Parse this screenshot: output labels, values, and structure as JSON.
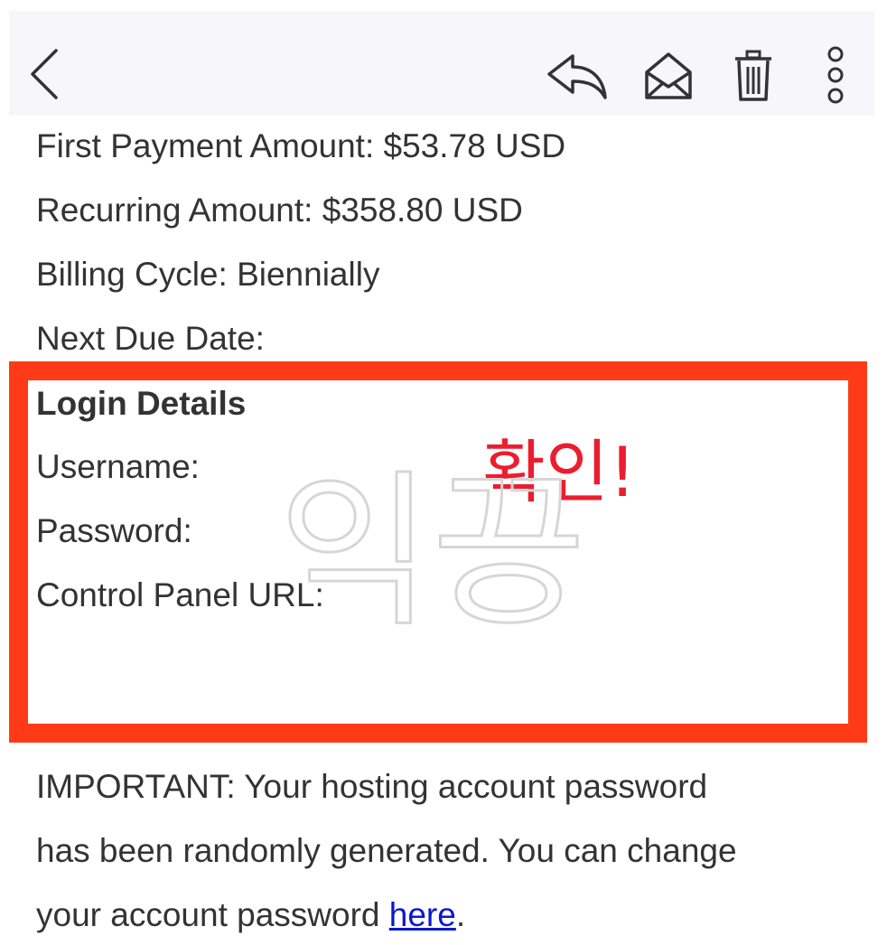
{
  "toolbar": {
    "back_icon": "chevron-left-icon",
    "reply_icon": "reply-icon",
    "mark_icon": "envelope-open-icon",
    "trash_icon": "trash-icon",
    "more_icon": "more-vertical-icon"
  },
  "order": {
    "first_payment": "First Payment Amount: $53.78 USD",
    "recurring": "Recurring Amount: $358.80 USD",
    "billing_cycle": "Billing Cycle: Biennially",
    "next_due": "Next Due Date:"
  },
  "login": {
    "heading": "Login Details",
    "username": "Username:",
    "password": "Password:",
    "control_panel": "Control Panel URL:"
  },
  "annotation": {
    "text": "확인!",
    "box_color": "#ff3b17",
    "text_color": "#ec1d2f"
  },
  "watermark": {
    "text": "익끙"
  },
  "important": {
    "line1": "IMPORTANT: Your hosting account password",
    "line2": "has been randomly generated. You can change",
    "line3_prefix": "your account password ",
    "link": "here",
    "line3_suffix": "."
  }
}
